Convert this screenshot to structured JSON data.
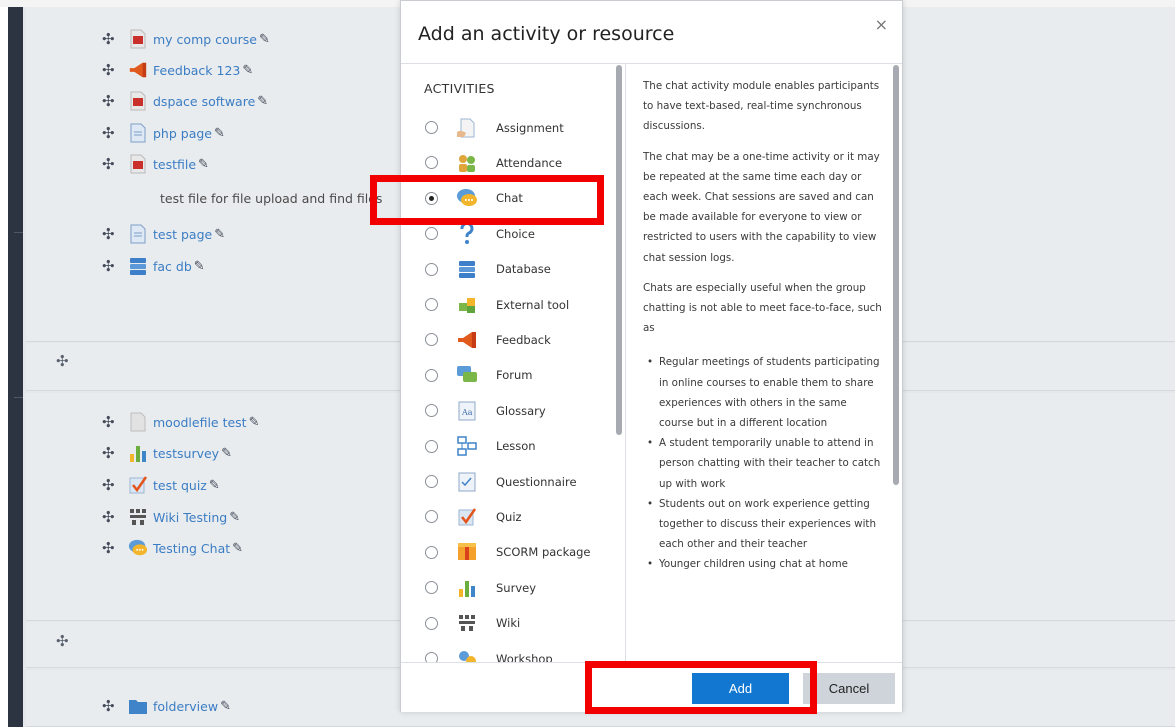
{
  "course": {
    "section_a": [
      {
        "label": "my comp course",
        "icon": "pdf-file-icon"
      },
      {
        "label": "Feedback 123",
        "icon": "megaphone-icon"
      },
      {
        "label": "dspace software",
        "icon": "pdf-file-icon"
      },
      {
        "label": "php page",
        "icon": "page-icon"
      },
      {
        "label": "testfile",
        "icon": "pdf-file-icon"
      }
    ],
    "file_description": "test file for file upload and find files",
    "section_a2": [
      {
        "label": "test page",
        "icon": "page-icon"
      },
      {
        "label": "fac db",
        "icon": "database-icon"
      }
    ],
    "section_b": [
      {
        "label": "moodlefile test",
        "icon": "file-icon"
      },
      {
        "label": "testsurvey",
        "icon": "survey-icon"
      },
      {
        "label": "test quiz",
        "icon": "quiz-icon"
      },
      {
        "label": "Wiki Testing",
        "icon": "wiki-icon"
      },
      {
        "label": "Testing Chat",
        "icon": "chat-icon"
      }
    ],
    "section_c": [
      {
        "label": "folderview",
        "icon": "folder-icon"
      }
    ],
    "move_glyph": "✣",
    "edit_glyph": "✎"
  },
  "modal": {
    "title": "Add an activity or resource",
    "close": "×",
    "heading": "ACTIVITIES",
    "selected": "Chat",
    "activities": [
      {
        "label": "Assignment",
        "icon": "assignment-icon",
        "selected": false
      },
      {
        "label": "Attendance",
        "icon": "attendance-icon",
        "selected": false
      },
      {
        "label": "Chat",
        "icon": "chat-icon",
        "selected": true
      },
      {
        "label": "Choice",
        "icon": "choice-icon",
        "selected": false
      },
      {
        "label": "Database",
        "icon": "database-icon",
        "selected": false
      },
      {
        "label": "External tool",
        "icon": "external-tool-icon",
        "selected": false
      },
      {
        "label": "Feedback",
        "icon": "megaphone-icon",
        "selected": false
      },
      {
        "label": "Forum",
        "icon": "forum-icon",
        "selected": false
      },
      {
        "label": "Glossary",
        "icon": "glossary-icon",
        "selected": false
      },
      {
        "label": "Lesson",
        "icon": "lesson-icon",
        "selected": false
      },
      {
        "label": "Questionnaire",
        "icon": "questionnaire-icon",
        "selected": false
      },
      {
        "label": "Quiz",
        "icon": "quiz-icon",
        "selected": false
      },
      {
        "label": "SCORM package",
        "icon": "scorm-icon",
        "selected": false
      },
      {
        "label": "Survey",
        "icon": "survey-icon",
        "selected": false
      },
      {
        "label": "Wiki",
        "icon": "wiki-icon",
        "selected": false
      },
      {
        "label": "Workshop",
        "icon": "workshop-icon",
        "selected": false
      }
    ],
    "description": {
      "p1": "The chat activity module enables participants to have text-based, real-time synchronous discussions.",
      "p2": "The chat may be a one-time activity or it may be repeated at the same time each day or each week. Chat sessions are saved and can be made available for everyone to view or restricted to users with the capability to view chat session logs.",
      "p3": "Chats are especially useful when the group chatting is not able to meet face-to-face, such as",
      "bullets": [
        "Regular meetings of students participating in online courses to enable them to share experiences with others in the same course but in a different location",
        "A student temporarily unable to attend in person chatting with their teacher to catch up with work",
        "Students out on work experience getting together to discuss their experiences with each other and their teacher",
        "Younger children using chat at home"
      ]
    },
    "add_label": "Add",
    "cancel_label": "Cancel"
  },
  "colors": {
    "accent": "#1177d1",
    "link": "#3b7dc4",
    "highlight": "#f20000",
    "sidebar": "#2b3440"
  }
}
